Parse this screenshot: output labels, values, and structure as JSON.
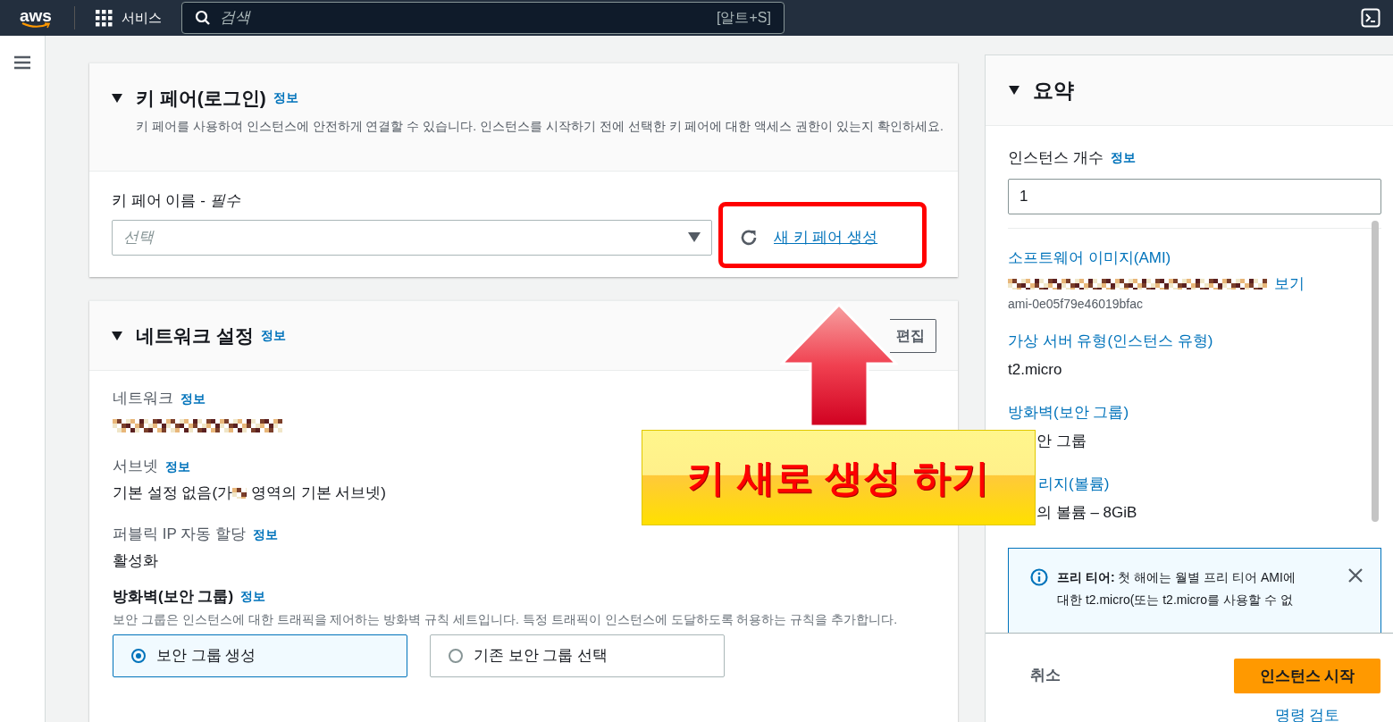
{
  "topbar": {
    "logo": "aws",
    "services": "서비스",
    "search_placeholder": "검색",
    "search_shortcut": "[알트+S]"
  },
  "key_pair": {
    "title": "키 페어(로그인)",
    "info": "정보",
    "description": "키 페어를 사용하여 인스턴스에 안전하게 연결할 수 있습니다. 인스턴스를 시작하기 전에 선택한 키 페어에 대한 액세스 권한이 있는지 확인하세요.",
    "field_label": "키 페어 이름 - *필수*",
    "placeholder": "선택",
    "create_link": "새 키 페어 생성"
  },
  "network": {
    "title": "네트워크 설정",
    "info": "정보",
    "edit_button": "편집",
    "fields": [
      {
        "kind": "redacted",
        "label": "네트워크",
        "info": "정보"
      },
      {
        "kind": "partly_redacted",
        "label": "서브넷",
        "info": "정보",
        "value_before": "기본 설정 없음(가",
        "value_after": " 영역의 기본 서브넷)"
      },
      {
        "kind": "text",
        "label": "퍼블릭 IP 자동 할당",
        "info": "정보",
        "value": "활성화"
      }
    ],
    "firewall": {
      "title": "방화벽(보안 그룹)",
      "info": "정보",
      "description": "보안 그룹은 인스턴스에 대한 트래픽을 제어하는 방화벽 규칙 세트입니다. 특정 트래픽이 인스턴스에 도달하도록 허용하는 규칙을 추가합니다.",
      "options": [
        {
          "label": "보안 그룹 생성",
          "selected": true
        },
        {
          "label": "기존 보안 그룹 선택",
          "selected": false
        }
      ]
    }
  },
  "summary": {
    "title": "요약",
    "count_label": "인스턴스 개수",
    "info": "정보",
    "count": "1",
    "items": [
      {
        "kind": "ami",
        "label": "소프트웨어 이미지(AMI)",
        "link": "보기",
        "value": "ami-0e05f79e46019bfac"
      },
      {
        "kind": "text",
        "label": "가상 서버 유형(인스턴스 유형)",
        "value": "t2.micro"
      },
      {
        "kind": "value_covered",
        "label": "방화벽(보안 그룹)",
        "value": "안 그룹"
      },
      {
        "kind": "both_covered",
        "label": "리지(볼륨)",
        "value": "의 볼륨 – 8GiB"
      }
    ],
    "alert": {
      "lines": [
        "**프리 티어:** 첫 해에는 월별 프리 티어 AMI에",
        "대한 t2.micro(또는 t2.micro를 사용할 수 없"
      ]
    },
    "cancel": "취소",
    "launch": "인스턴스 시작",
    "review": "명령 검토"
  },
  "annotation": {
    "callout": "키 새로 생성 하기"
  }
}
